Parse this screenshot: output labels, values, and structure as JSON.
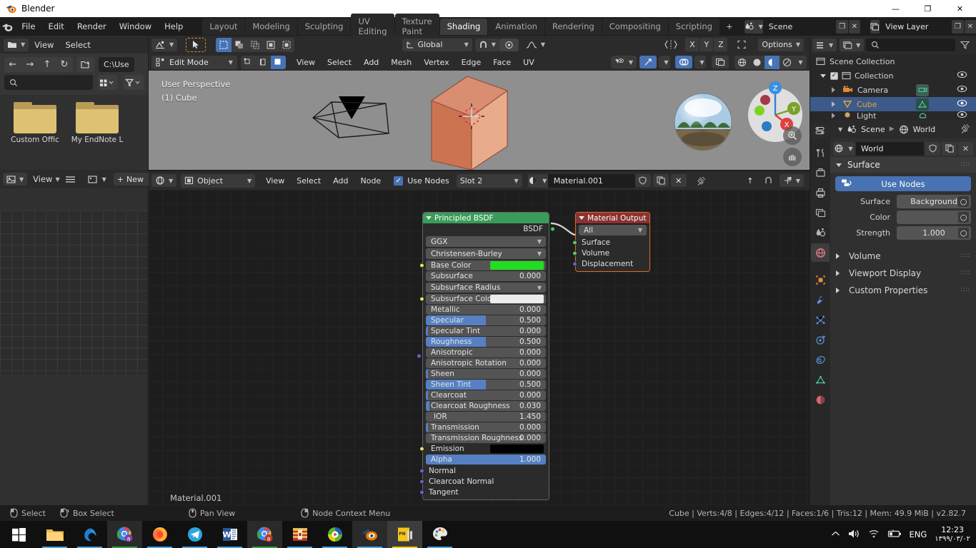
{
  "window": {
    "title": "Blender",
    "minimize": "—",
    "maximize": "❐",
    "close": "✕"
  },
  "topbar": {
    "menus": [
      "File",
      "Edit",
      "Render",
      "Window",
      "Help"
    ],
    "workspaces": [
      "Layout",
      "Modeling",
      "Sculpting",
      "UV Editing",
      "Texture Paint",
      "Shading",
      "Animation",
      "Rendering",
      "Compositing",
      "Scripting"
    ],
    "active_workspace": "Shading",
    "add_workspace": "+",
    "scene_name": "Scene",
    "view_layer_name": "View Layer"
  },
  "file_browser": {
    "menus": [
      "View",
      "Select"
    ],
    "path": "C:\\Use",
    "search_placeholder": "",
    "files": [
      "Custom Offic",
      "My EndNote L"
    ]
  },
  "image_editor": {
    "view_label": "View",
    "new_label": "New"
  },
  "viewport": {
    "transform_orientation": "Global",
    "options_label": "Options",
    "axes": [
      "X",
      "Y",
      "Z"
    ],
    "mode": "Edit Mode",
    "menus": [
      "View",
      "Select",
      "Add",
      "Mesh",
      "Vertex",
      "Edge",
      "Face",
      "UV"
    ],
    "overlay_text_1": "User Perspective",
    "overlay_text_2": "(1) Cube",
    "gizmo_axes": [
      "X",
      "Y",
      "Z"
    ]
  },
  "shader_editor": {
    "shader_type": "Object",
    "menus": [
      "View",
      "Select",
      "Add",
      "Node"
    ],
    "use_nodes_label": "Use Nodes",
    "use_nodes_checked": true,
    "slot": "Slot 2",
    "material_name": "Material.001",
    "canvas_material_label": "Material.001"
  },
  "nodes": {
    "principled": {
      "title": "Principled BSDF",
      "header_color": "#3a9c5a",
      "output_socket": "BSDF",
      "distribution": "GGX",
      "subsurface_method": "Christensen-Burley",
      "inputs": [
        {
          "label": "Base Color",
          "type": "color",
          "color": "#22dd22",
          "socket": "yellow"
        },
        {
          "label": "Subsurface",
          "type": "value",
          "value": "0.000",
          "fill": 0,
          "socket": "gray"
        },
        {
          "label": "Subsurface Radius",
          "type": "menu",
          "socket": "purple"
        },
        {
          "label": "Subsurface Color",
          "type": "color",
          "color": "#ececec",
          "socket": "yellow"
        },
        {
          "label": "Metallic",
          "type": "value",
          "value": "0.000",
          "fill": 0,
          "socket": "gray"
        },
        {
          "label": "Specular",
          "type": "value",
          "value": "0.500",
          "fill": 50,
          "socket": "gray"
        },
        {
          "label": "Specular Tint",
          "type": "value",
          "value": "0.000",
          "fill": 2,
          "socket": "gray"
        },
        {
          "label": "Roughness",
          "type": "value",
          "value": "0.500",
          "fill": 50,
          "socket": "gray"
        },
        {
          "label": "Anisotropic",
          "type": "value",
          "value": "0.000",
          "fill": 0,
          "socket": "gray"
        },
        {
          "label": "Anisotropic Rotation",
          "type": "value",
          "value": "0.000",
          "fill": 0,
          "socket": "gray"
        },
        {
          "label": "Sheen",
          "type": "value",
          "value": "0.000",
          "fill": 2,
          "socket": "gray"
        },
        {
          "label": "Sheen Tint",
          "type": "value",
          "value": "0.500",
          "fill": 50,
          "socket": "gray"
        },
        {
          "label": "Clearcoat",
          "type": "value",
          "value": "0.000",
          "fill": 2,
          "socket": "gray"
        },
        {
          "label": "Clearcoat Roughness",
          "type": "value",
          "value": "0.030",
          "fill": 3,
          "socket": "gray"
        },
        {
          "label": "IOR",
          "type": "value",
          "value": "1.450",
          "fill": 0,
          "socket": "gray"
        },
        {
          "label": "Transmission",
          "type": "value",
          "value": "0.000",
          "fill": 2,
          "socket": "gray"
        },
        {
          "label": "Transmission Roughness",
          "type": "value",
          "value": "0.000",
          "fill": 0,
          "socket": "gray"
        },
        {
          "label": "Emission",
          "type": "color",
          "color": "#000000",
          "socket": "yellow"
        },
        {
          "label": "Alpha",
          "type": "value",
          "value": "1.000",
          "fill": 100,
          "socket": "gray"
        },
        {
          "label": "Normal",
          "type": "plain",
          "socket": "purple"
        },
        {
          "label": "Clearcoat Normal",
          "type": "plain",
          "socket": "purple"
        },
        {
          "label": "Tangent",
          "type": "plain",
          "socket": "purple"
        }
      ]
    },
    "material_output": {
      "title": "Material Output",
      "header_color": "#8a3232",
      "target": "All",
      "inputs": [
        {
          "label": "Surface",
          "socket": "green"
        },
        {
          "label": "Volume",
          "socket": "green"
        },
        {
          "label": "Displacement",
          "socket": "purple"
        }
      ]
    }
  },
  "outliner": {
    "search_placeholder": "",
    "rows": [
      {
        "label": "Scene Collection",
        "indent": 0,
        "icon": "collection-icon",
        "selected": false,
        "eye": false
      },
      {
        "label": "Collection",
        "indent": 1,
        "icon": "collection-icon",
        "selected": false,
        "eye": true,
        "checkbox": true
      },
      {
        "label": "Camera",
        "indent": 2,
        "icon": "camera-icon",
        "selected": false,
        "eye": true
      },
      {
        "label": "Cube",
        "indent": 2,
        "icon": "mesh-icon",
        "selected": true,
        "eye": true
      },
      {
        "label": "Light",
        "indent": 2,
        "icon": "light-icon",
        "selected": false,
        "eye": true
      }
    ]
  },
  "properties": {
    "breadcrumb": [
      "Scene",
      "World"
    ],
    "id_name": "World",
    "panels": [
      {
        "label": "Surface",
        "open": true
      },
      {
        "label": "Volume",
        "open": false
      },
      {
        "label": "Viewport Display",
        "open": false
      },
      {
        "label": "Custom Properties",
        "open": false
      }
    ],
    "use_nodes_label": "Use Nodes",
    "fields": [
      {
        "label": "Surface",
        "value": "Background",
        "kind": "menu"
      },
      {
        "label": "Color",
        "value": "",
        "kind": "color"
      },
      {
        "label": "Strength",
        "value": "1.000",
        "kind": "number"
      }
    ],
    "tabs": [
      "tool-icon",
      "render-icon",
      "output-icon",
      "view-layer-icon",
      "scene-icon",
      "world-icon",
      "object-icon",
      "modifier-icon",
      "particles-icon",
      "physics-icon",
      "constraints-icon",
      "data-icon",
      "material-icon"
    ],
    "active_tab": "world-icon"
  },
  "statusbar": {
    "hints": [
      {
        "icon": "mouse-left-icon",
        "label": "Select"
      },
      {
        "icon": "mouse-left-drag-icon",
        "label": "Box Select"
      },
      {
        "icon": "mouse-middle-icon",
        "label": "Pan View"
      },
      {
        "icon": "mouse-right-icon",
        "label": "Node Context Menu"
      }
    ],
    "stats": "Cube | Verts:4/8 | Edges:4/12 | Faces:1/6 | Tris:12 | Mem: 49.9 MiB | v2.82.7"
  },
  "taskbar": {
    "apps": [
      "file-explorer-icon",
      "edge-icon",
      "chrome-icon",
      "firefox-icon",
      "telegram-icon",
      "word-icon",
      "chrome-icon-2",
      "winrar-icon",
      "kmplayer-icon",
      "blender-icon",
      "pdf-icon",
      "paint-icon"
    ],
    "language": "ENG",
    "time": "12:23",
    "date": "۱۳۹۹/۰۳/۰۲"
  }
}
